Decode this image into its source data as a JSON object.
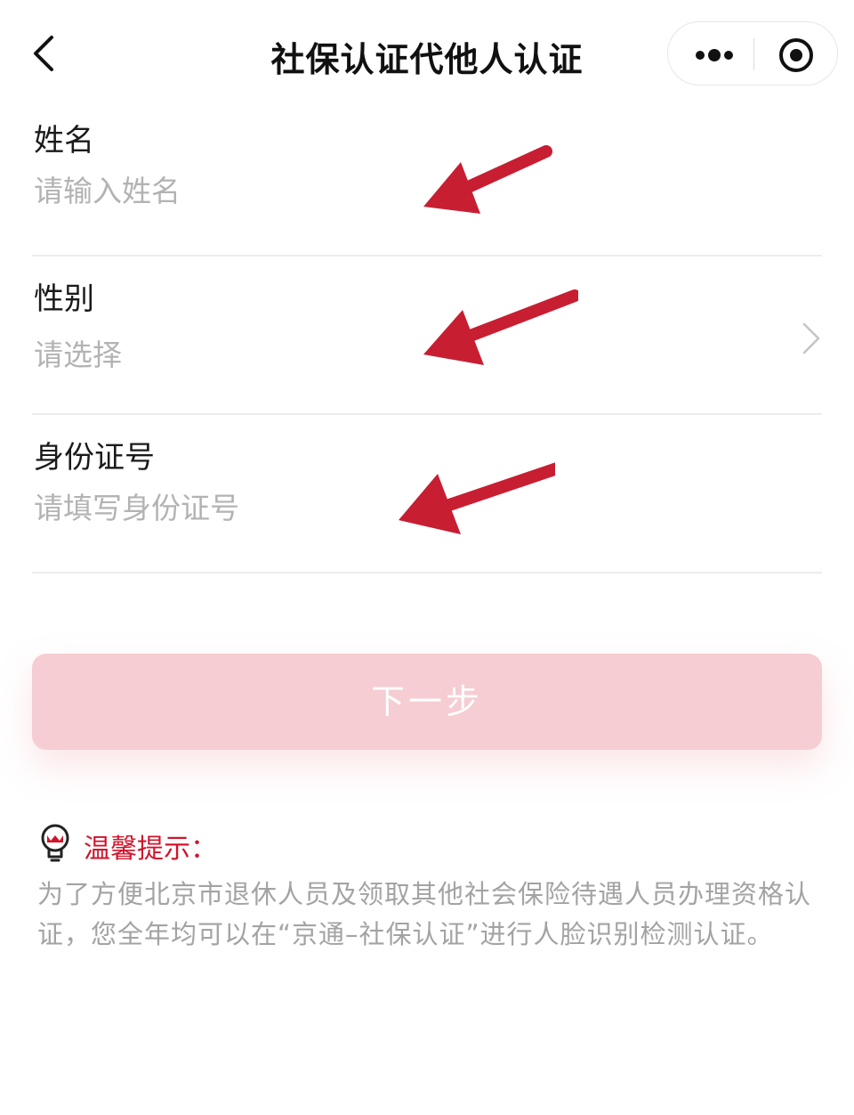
{
  "header": {
    "title": "社保认证代他人认证",
    "back_icon": "chevron-left-icon",
    "more_icon": "more-dots-icon",
    "close_icon": "target-close-icon"
  },
  "form": {
    "name": {
      "label": "姓名",
      "placeholder": "请输入姓名",
      "value": ""
    },
    "gender": {
      "label": "性别",
      "placeholder": "请选择",
      "icon": "chevron-right-icon"
    },
    "id_number": {
      "label": "身份证号",
      "placeholder": "请填写身份证号",
      "value": ""
    }
  },
  "next_button": {
    "label": "下一步"
  },
  "tips": {
    "icon": "lightbulb-icon",
    "title": "温馨提示：",
    "body": "为了方便北京市退休人员及领取其他社会保险待遇人员办理资格认证，您全年均可以在“京通–社保认证”进行人脸识别检测认证。"
  },
  "colors": {
    "accent": "#d0142c",
    "arrow": "#c81e32",
    "button_disabled": "#f5cdd2",
    "placeholder": "#b3b3b3",
    "tip_text": "#a3a3a3"
  }
}
